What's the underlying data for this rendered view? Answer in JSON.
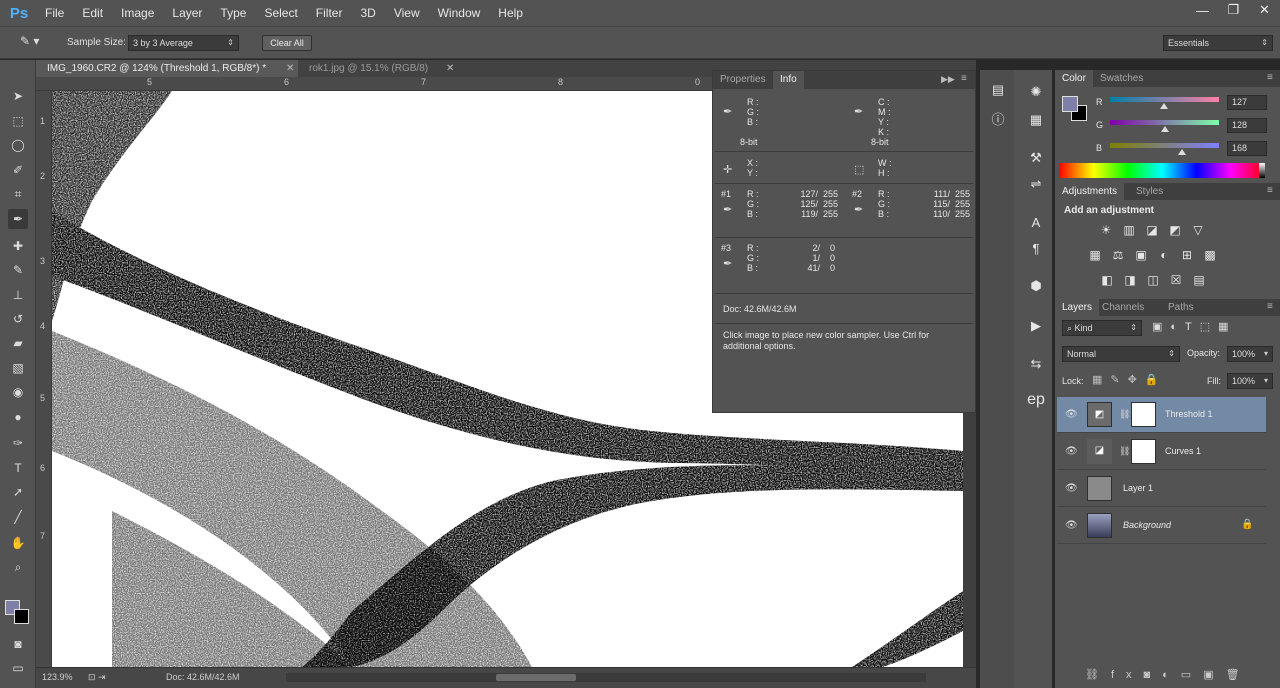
{
  "app": {
    "logo": "Ps"
  },
  "menu": [
    "File",
    "Edit",
    "Image",
    "Layer",
    "Type",
    "Select",
    "Filter",
    "3D",
    "View",
    "Window",
    "Help"
  ],
  "window_controls": {
    "minimize": "—",
    "restore": "❐",
    "close": "✕"
  },
  "options": {
    "sample_size_label": "Sample Size:",
    "sample_size_value": "3 by 3 Average",
    "clear_all": "Clear All",
    "workspace": "Essentials"
  },
  "tabs": [
    {
      "title": "IMG_1960.CR2 @ 124% (Threshold 1, RGB/8*) *",
      "close": "✕"
    },
    {
      "title": "rok1.jpg @ 15.1% (RGB/8)",
      "close": "✕"
    }
  ],
  "ruler_top_labels": [
    "5",
    "6",
    "7",
    "8",
    "0"
  ],
  "ruler_left_labels": [
    "1",
    "2",
    "3",
    "4",
    "5",
    "6",
    "7"
  ],
  "info": {
    "tabs": [
      "Properties",
      "Info"
    ],
    "rgb_labels": [
      "R :",
      "G :",
      "B :"
    ],
    "cmyk_labels": [
      "C :",
      "M :",
      "Y :",
      "K :"
    ],
    "bit_left": "8-bit",
    "bit_right": "8-bit",
    "xy_labels": [
      "X :",
      "Y :"
    ],
    "wh_labels": [
      "W :",
      "H :"
    ],
    "s1": {
      "id": "#1",
      "R": "127/  255",
      "G": "125/  255",
      "B": "119/  255"
    },
    "s2": {
      "id": "#2",
      "R": "111/  255",
      "G": "115/  255",
      "B": "110/  255"
    },
    "s3": {
      "id": "#3",
      "R": "2/    0",
      "G": "1/    0",
      "B": "41/    0"
    },
    "doc": "Doc: 42.6M/42.6M",
    "hint": "Click image to place new color sampler.  Use Ctrl for additional options."
  },
  "color": {
    "tabs": [
      "Color",
      "Swatches"
    ],
    "labels": [
      "R",
      "G",
      "B"
    ],
    "values": [
      "127",
      "128",
      "168"
    ],
    "fraction": [
      0.498,
      0.502,
      0.659
    ],
    "swatch": "#7f80a8"
  },
  "adjustments": {
    "tabs": [
      "Adjustments",
      "Styles"
    ],
    "title": "Add an adjustment",
    "icons_row1": [
      "☀",
      "▥",
      "◪",
      "◩",
      "▽"
    ],
    "icons_row2": [
      "▦",
      "⚖",
      "▣",
      "◐",
      "⊞"
    ],
    "icons_row3": [
      "◧",
      "◨",
      "◫",
      "☒",
      "▤"
    ]
  },
  "layers": {
    "tabs": [
      "Layers",
      "Channels",
      "Paths"
    ],
    "kind": "Kind",
    "blend_mode": "Normal",
    "opacity_label": "Opacity:",
    "opacity_value": "100%",
    "lock_label": "Lock:",
    "fill_label": "Fill:",
    "fill_value": "100%",
    "items": [
      {
        "name": "Threshold 1",
        "selected": true
      },
      {
        "name": "Curves 1"
      },
      {
        "name": "Layer 1"
      },
      {
        "name": "Background",
        "locked": true
      }
    ]
  },
  "status": {
    "zoom": "123.9%",
    "doc": "Doc: 42.6M/42.6M"
  },
  "strip": {
    "ep": "ep"
  }
}
